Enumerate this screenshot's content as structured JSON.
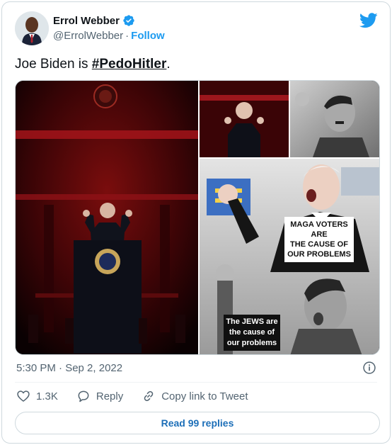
{
  "author": {
    "name": "Errol Webber",
    "handle": "@ErrolWebber",
    "separator": "·",
    "follow_label": "Follow"
  },
  "tweet": {
    "text_prefix": "Joe Biden is ",
    "hashtag": "#PedoHitler",
    "text_suffix": "."
  },
  "media": {
    "caption_maga": "MAGA VOTERS ARE THE CAUSE OF OUR PROBLEMS",
    "caption_maga_lines": [
      "MAGA VOTERS ARE",
      "THE CAUSE OF",
      "OUR PROBLEMS"
    ],
    "caption_jews_lines": [
      "The JEWS are",
      "the cause of",
      "our problems"
    ]
  },
  "meta": {
    "timestamp": "5:30 PM · Sep 2, 2022"
  },
  "actions": {
    "like_count": "1.3K",
    "reply_label": "Reply",
    "copy_link_label": "Copy link to Tweet"
  },
  "replies_button": "Read 99 replies",
  "icons": {
    "verified": "verified-badge-icon",
    "brand": "twitter-bird-icon",
    "info": "info-icon",
    "like": "heart-icon",
    "reply": "speech-bubble-icon",
    "copy": "link-icon"
  },
  "colors": {
    "accent": "#1d9bf0",
    "secondary_text": "#536471",
    "border": "#cfd9de"
  }
}
